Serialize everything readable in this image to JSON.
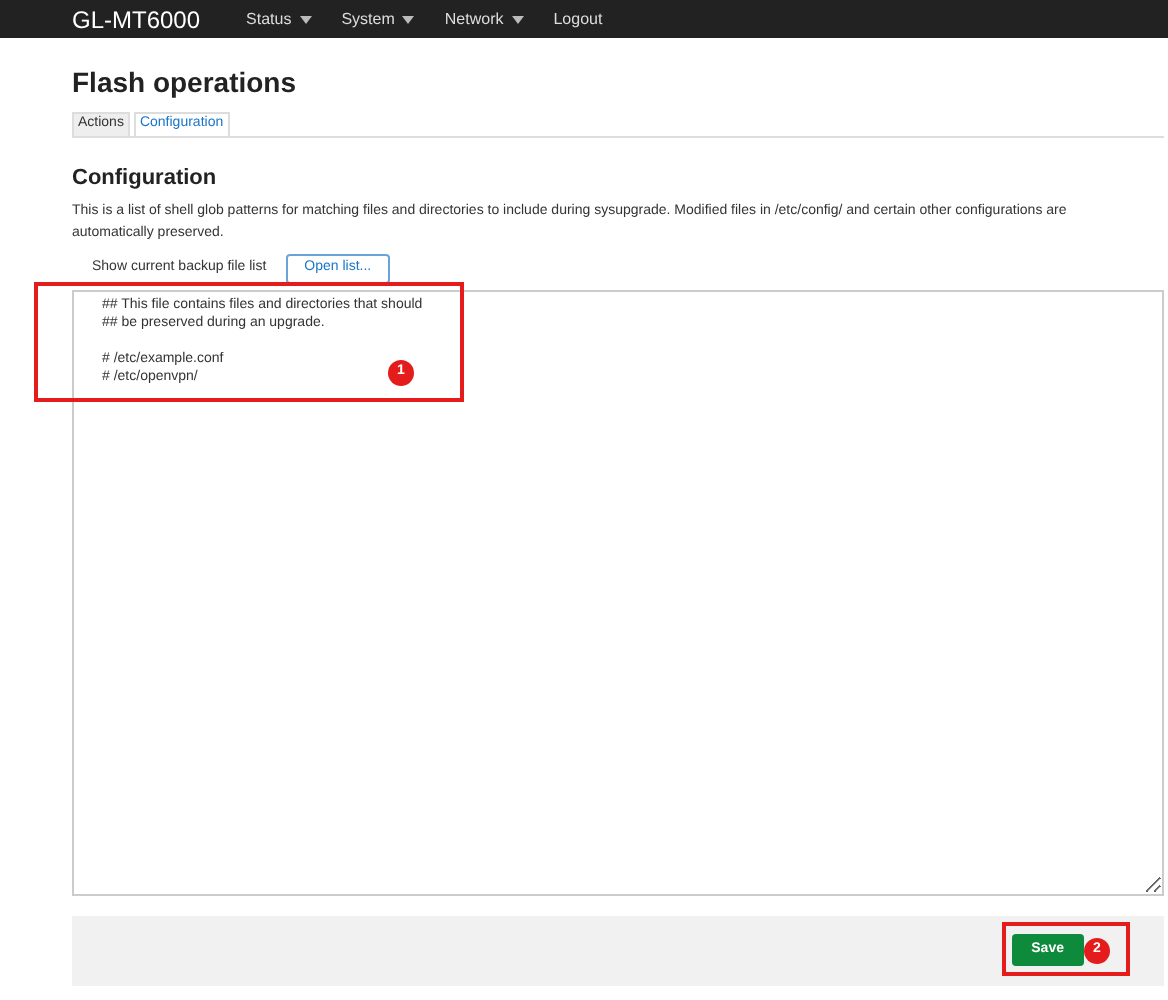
{
  "navbar": {
    "brand": "GL-MT6000",
    "menu": [
      {
        "label": "Status",
        "dropdown": true
      },
      {
        "label": "System",
        "dropdown": true
      },
      {
        "label": "Network",
        "dropdown": true
      },
      {
        "label": "Logout",
        "dropdown": false
      }
    ]
  },
  "page_title": "Flash operations",
  "tabs": [
    {
      "label": "Actions",
      "selected": false
    },
    {
      "label": "Configuration",
      "selected": true
    }
  ],
  "section": {
    "title": "Configuration",
    "description": "This is a list of shell glob patterns for matching files and directories to include during sysupgrade. Modified files in /etc/config/ and certain other configurations are automatically preserved.",
    "backup_label": "Show current backup file list",
    "open_button": "Open list...",
    "editor_value": "## This file contains files and directories that should\n## be preserved during an upgrade.\n\n# /etc/example.conf\n# /etc/openvpn/"
  },
  "save_button": "Save",
  "annotations": [
    {
      "number": "1"
    },
    {
      "number": "2"
    }
  ]
}
